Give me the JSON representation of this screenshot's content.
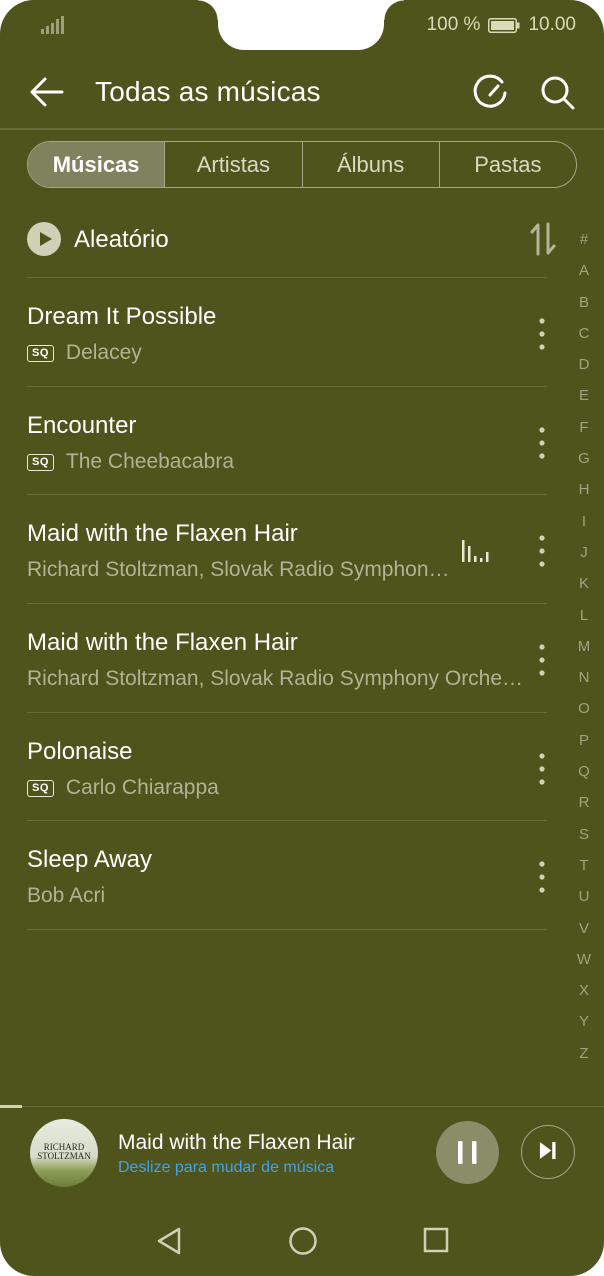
{
  "status_bar": {
    "battery_percent": "100 %",
    "time": "10.00",
    "signal_icon": "signal-icon",
    "battery_icon": "battery-icon"
  },
  "header": {
    "title": "Todas as músicas",
    "back_icon": "arrow-left-icon",
    "refresh_icon": "refresh-icon",
    "search_icon": "search-icon"
  },
  "tabs": [
    {
      "label": "Músicas",
      "active": true
    },
    {
      "label": "Artistas",
      "active": false
    },
    {
      "label": "Álbuns",
      "active": false
    },
    {
      "label": "Pastas",
      "active": false
    }
  ],
  "shuffle": {
    "label": "Aleatório",
    "icon": "play-circle-icon",
    "sort_icon": "sort-icon"
  },
  "songs": [
    {
      "title": "Dream It Possible",
      "artist": "Delacey",
      "sq": true,
      "playing": false
    },
    {
      "title": "Encounter",
      "artist": "The Cheebacabra",
      "sq": true,
      "playing": false
    },
    {
      "title": "Maid with the Flaxen Hair",
      "artist": "Richard Stoltzman, Slovak Radio Symphon…",
      "sq": false,
      "playing": true
    },
    {
      "title": "Maid with the Flaxen Hair",
      "artist": "Richard Stoltzman, Slovak Radio Symphony Orche…",
      "sq": false,
      "playing": false
    },
    {
      "title": "Polonaise",
      "artist": "Carlo Chiarappa",
      "sq": true,
      "playing": false
    },
    {
      "title": "Sleep Away",
      "artist": "Bob Acri",
      "sq": false,
      "playing": false
    }
  ],
  "sq_label": "SQ",
  "alpha_index": [
    "#",
    "A",
    "B",
    "C",
    "D",
    "E",
    "F",
    "G",
    "H",
    "I",
    "J",
    "K",
    "L",
    "M",
    "N",
    "O",
    "P",
    "Q",
    "R",
    "S",
    "T",
    "U",
    "V",
    "W",
    "X",
    "Y",
    "Z"
  ],
  "mini_player": {
    "title": "Maid with the Flaxen Hair",
    "hint": "Deslize para mudar de música",
    "album_art_text": [
      "RICHARD",
      "STOLTZMAN"
    ],
    "pause_icon": "pause-icon",
    "next_icon": "skip-next-icon"
  },
  "nav_bar": {
    "back_icon": "nav-back-icon",
    "home_icon": "nav-home-icon",
    "recents_icon": "nav-recents-icon"
  },
  "colors": {
    "background": "#4f531c",
    "active_tab": "#7f825c",
    "hint_blue": "#46a2e0"
  }
}
